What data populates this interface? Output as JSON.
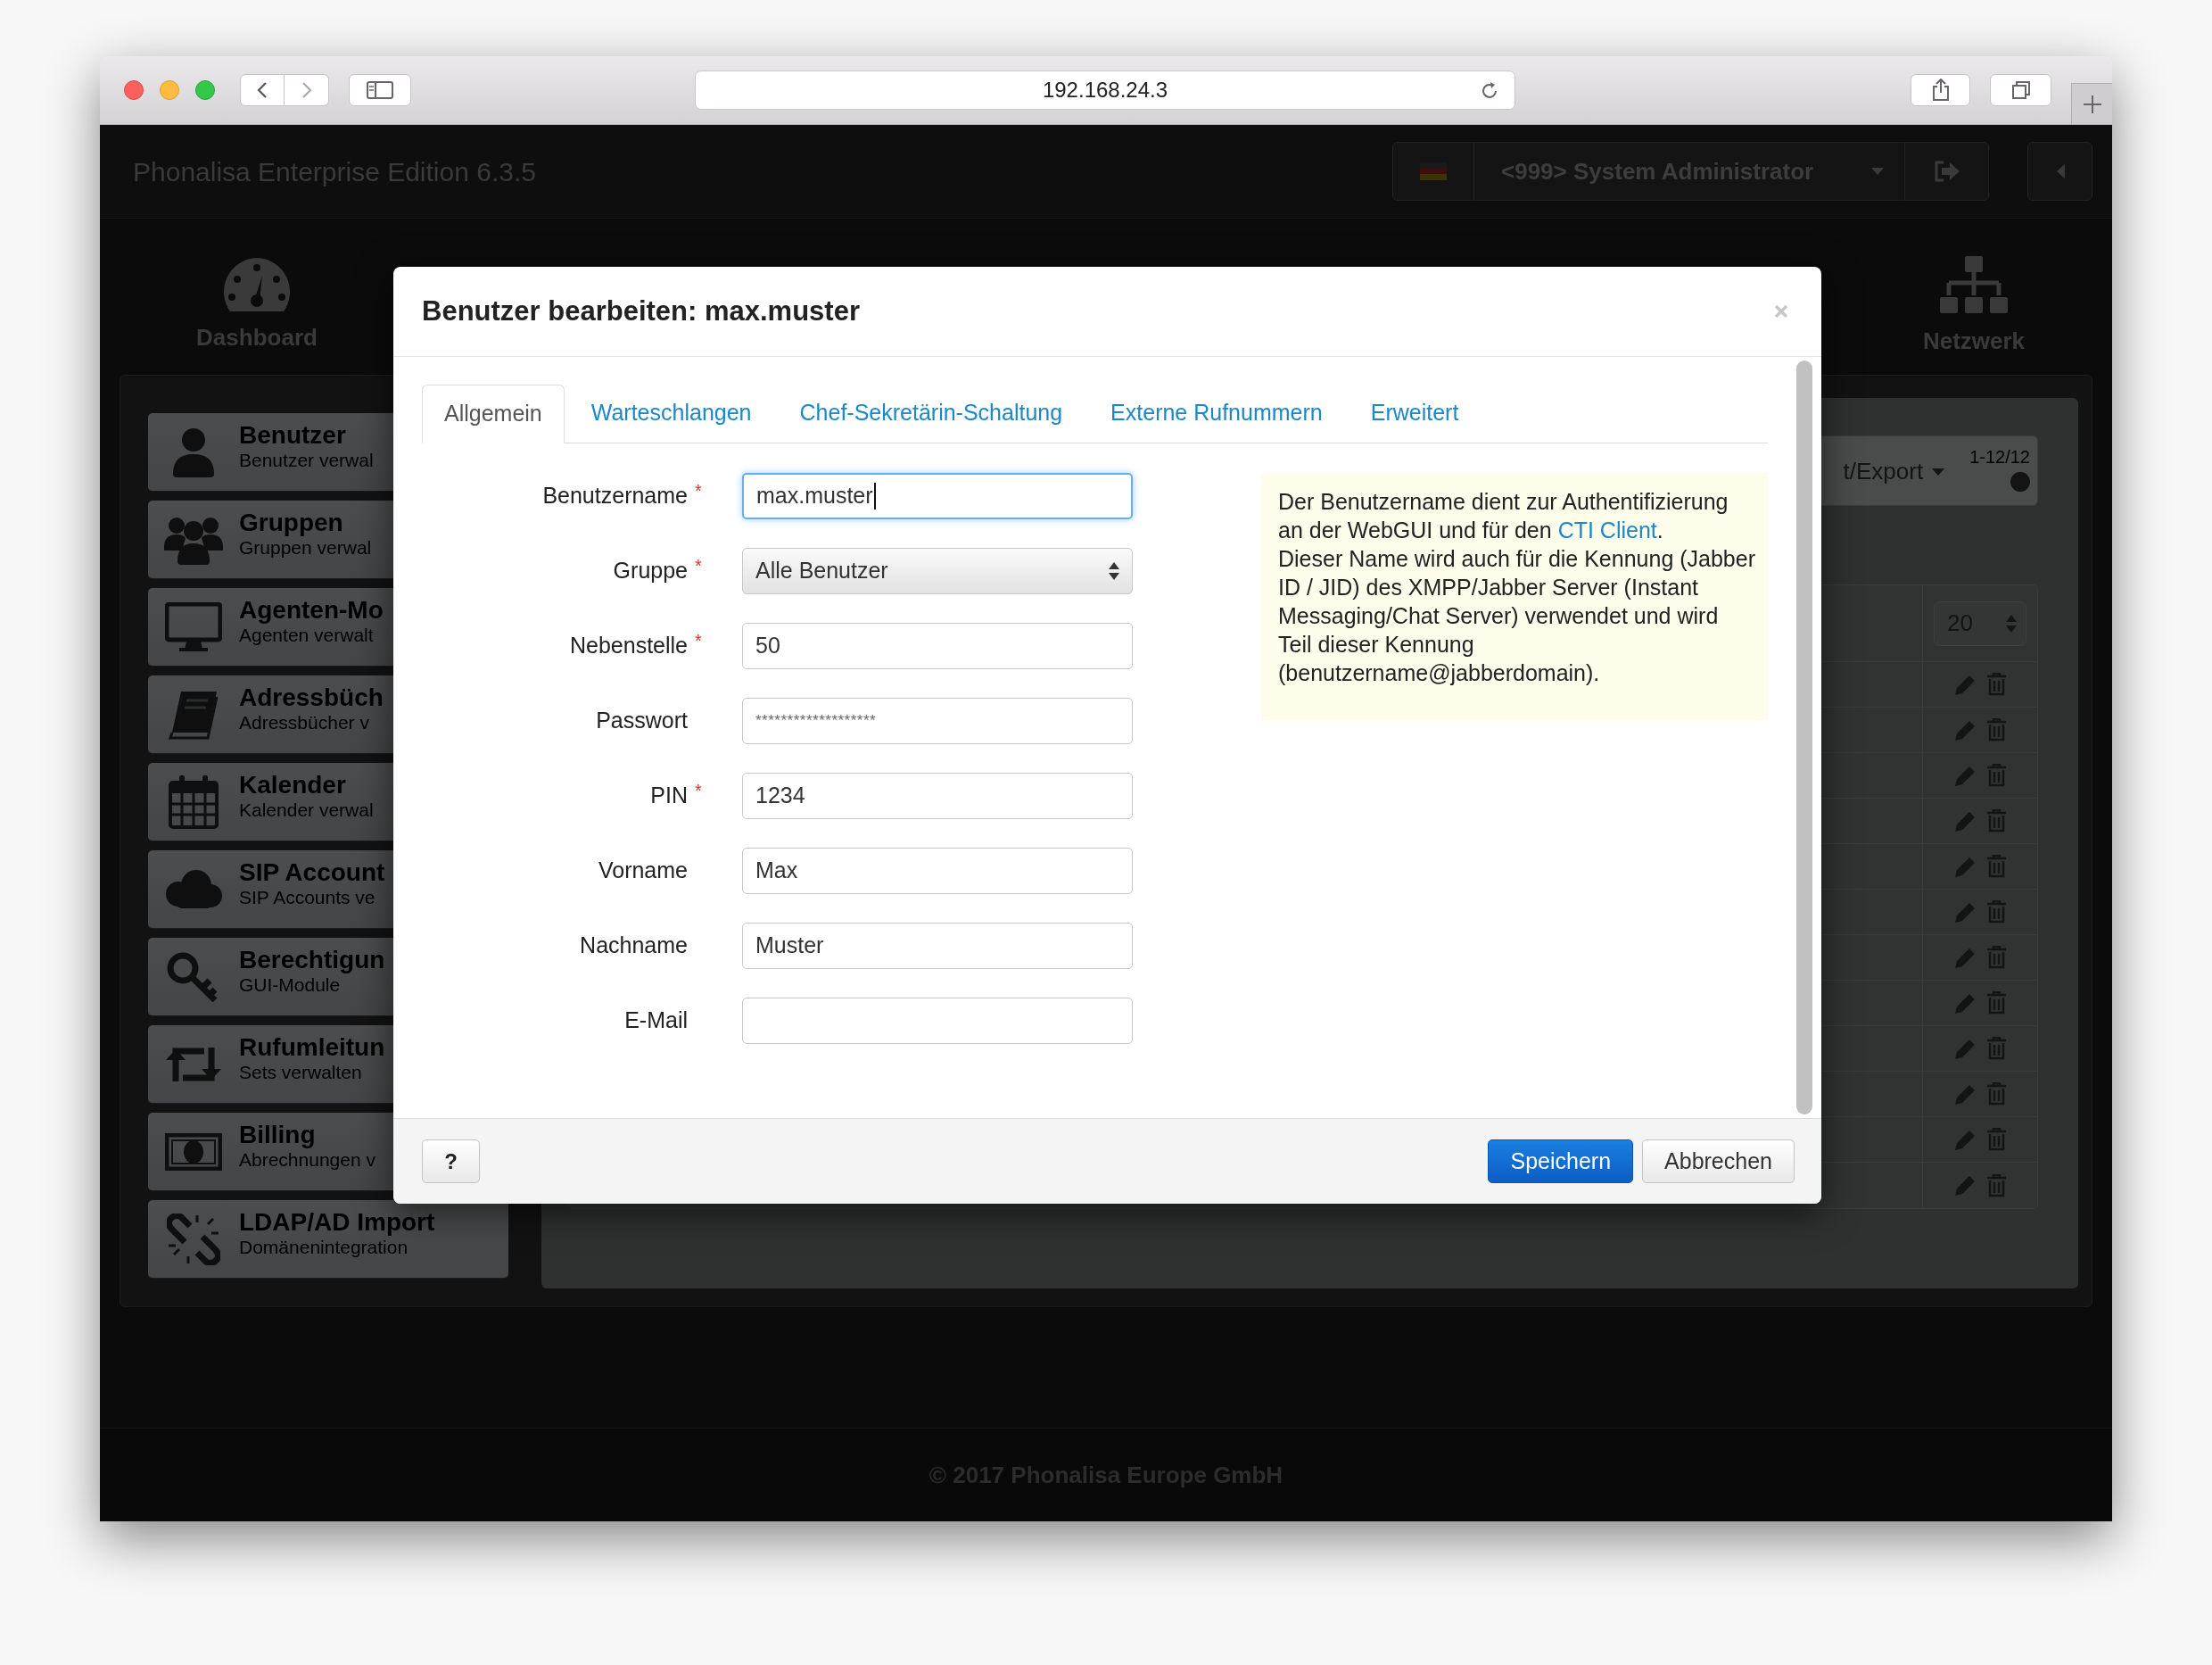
{
  "browser": {
    "url": "192.168.24.3"
  },
  "app": {
    "title": "Phonalisa Enterprise Edition 6.3.5",
    "user": "<999> System Administrator"
  },
  "nav": [
    {
      "label": "Dashboard"
    },
    {
      "label": "Netzwerk"
    }
  ],
  "sidebar": {
    "items": [
      {
        "title": "Benutzer",
        "subtitle": "Benutzer verwal"
      },
      {
        "title": "Gruppen",
        "subtitle": "Gruppen verwal"
      },
      {
        "title": "Agenten-Mo",
        "subtitle": "Agenten verwalt"
      },
      {
        "title": "Adressbüch",
        "subtitle": "Adressbücher v"
      },
      {
        "title": "Kalender",
        "subtitle": "Kalender verwal"
      },
      {
        "title": "SIP Account",
        "subtitle": "SIP Accounts ve"
      },
      {
        "title": "Berechtigun",
        "subtitle": "GUI-Module"
      },
      {
        "title": "Rufumleitun",
        "subtitle": "Sets verwalten"
      },
      {
        "title": "Billing",
        "subtitle": "Abrechnungen v"
      },
      {
        "title": "LDAP/AD Import",
        "subtitle": "Domänenintegration"
      }
    ]
  },
  "list_panel": {
    "toolbar_label": "t/Export",
    "count": "1-12/12",
    "page_size": "20",
    "rows": [
      {
        "kind": "user_row"
      },
      {
        "kind": "user_row"
      },
      {
        "kind": "user_row"
      },
      {
        "kind": "user_row"
      },
      {
        "kind": "user_row"
      },
      {
        "kind": "user_row"
      },
      {
        "kind": "user_row"
      },
      {
        "kind": "user_row"
      },
      {
        "kind": "user_row"
      },
      {
        "kind": "user_row"
      },
      {
        "kind": "user_row"
      },
      {
        "kind": "user_row"
      }
    ]
  },
  "dialog": {
    "title": "Benutzer bearbeiten: max.muster",
    "tabs": [
      {
        "label": "Allgemein",
        "selected": true
      },
      {
        "label": "Warteschlangen",
        "selected": false
      },
      {
        "label": "Chef-Sekretärin-Schaltung",
        "selected": false
      },
      {
        "label": "Externe Rufnummern",
        "selected": false
      },
      {
        "label": "Erweitert",
        "selected": false
      }
    ],
    "required_mark": "*",
    "fields": [
      {
        "label": "Benutzername",
        "required": true,
        "kind": "text",
        "value": "max.muster",
        "focused": true
      },
      {
        "label": "Gruppe",
        "required": true,
        "kind": "select",
        "value": "Alle Benutzer",
        "focused": false
      },
      {
        "label": "Nebenstelle",
        "required": true,
        "kind": "text",
        "value": "50",
        "focused": false
      },
      {
        "label": "Passwort",
        "required": false,
        "kind": "password",
        "value": "*******************",
        "focused": false
      },
      {
        "label": "PIN",
        "required": true,
        "kind": "text",
        "value": "1234",
        "focused": false
      },
      {
        "label": "Vorname",
        "required": false,
        "kind": "text",
        "value": "Max",
        "focused": false
      },
      {
        "label": "Nachname",
        "required": false,
        "kind": "text",
        "value": "Muster",
        "focused": false
      },
      {
        "label": "E-Mail",
        "required": false,
        "kind": "text",
        "focused": false
      }
    ],
    "help": {
      "before": "Der Benutzername dient zur Authentifizierung an der WebGUI und für den ",
      "link": "CTI Client",
      "after": ".",
      "second": "Dieser Name wird auch für die Kennung (Jabber ID / JID) des XMPP/Jabber Server (Instant Messaging/Chat Server) verwendet und wird Teil dieser Kennung (benutzername@jabberdomain)."
    },
    "help_button": "?",
    "buttons": [
      {
        "label": "Speichern",
        "kind": "primary"
      },
      {
        "label": "Abbrechen",
        "kind": "default"
      }
    ]
  },
  "footer": "© 2017 Phonalisa Europe GmbH"
}
